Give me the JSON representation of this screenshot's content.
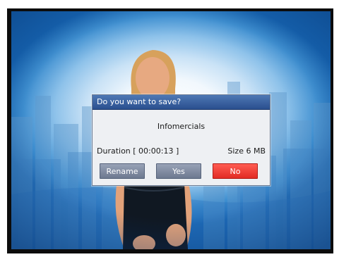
{
  "dialog": {
    "title": "Do you want to save?",
    "filename": "Infomercials",
    "duration_label": "Duration [ 00:00:13 ]",
    "size_label": "Size 6 MB",
    "buttons": {
      "rename": "Rename",
      "yes": "Yes",
      "no": "No"
    }
  },
  "colors": {
    "titlebar": "#3a62a1",
    "button_gray": "#7f8aa0",
    "button_selected": "#f0403a",
    "dialog_body": "#eef0f3"
  }
}
